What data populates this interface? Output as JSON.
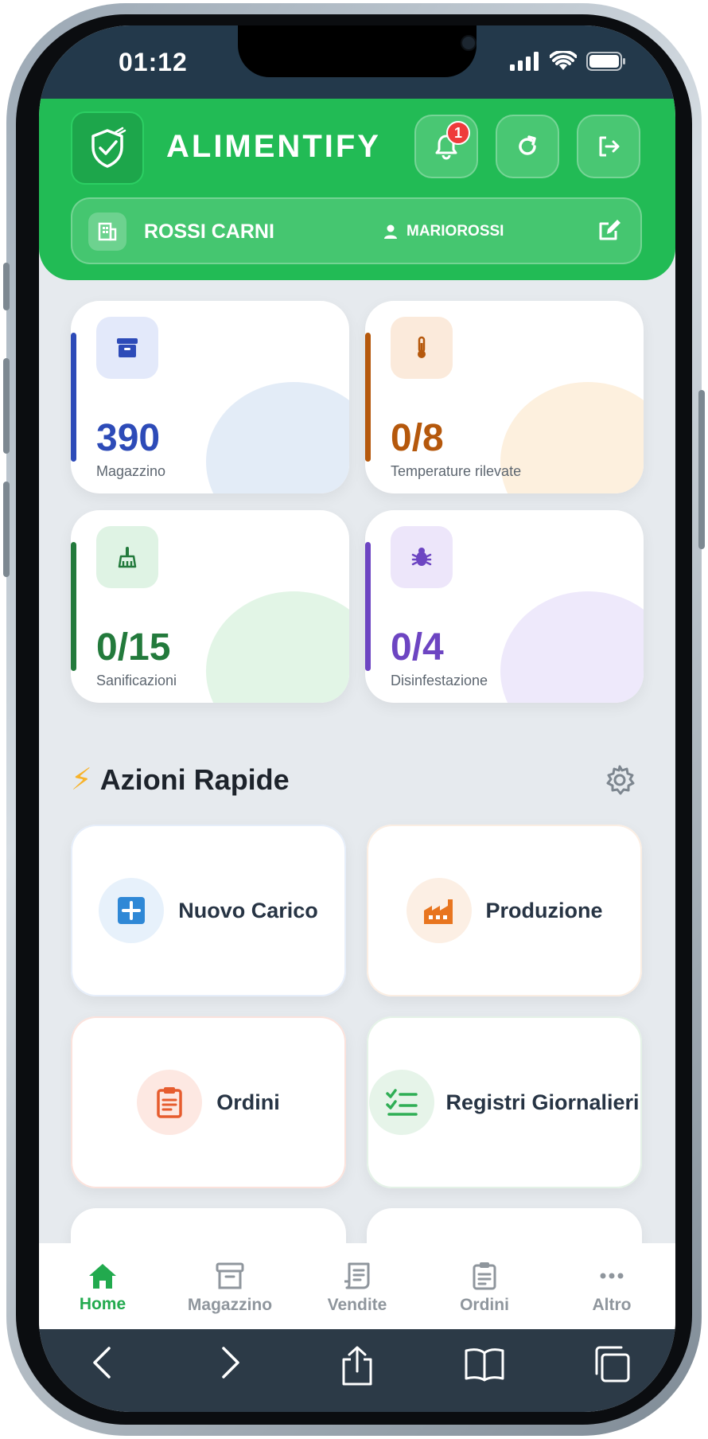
{
  "status_bar": {
    "time": "01:12"
  },
  "header": {
    "brand": "ALIMENTIFY",
    "notifications_count": "1",
    "company_name": "ROSSI CARNI",
    "username": "MARIOROSSI"
  },
  "stats": [
    {
      "value": "390",
      "label": "Magazzino",
      "color": "#2d4bb8",
      "icon": "archive-icon"
    },
    {
      "value": "0/8",
      "label": "Temperature rilevate",
      "color": "#b5580c",
      "icon": "thermometer-icon"
    },
    {
      "value": "0/15",
      "label": "Sanificazioni",
      "color": "#237a3c",
      "icon": "broom-icon"
    },
    {
      "value": "0/4",
      "label": "Disinfestazione",
      "color": "#6d45c2",
      "icon": "bug-icon"
    }
  ],
  "quick_actions": {
    "title": "Azioni Rapide",
    "items": [
      {
        "label": "Nuovo Carico",
        "icon": "plus-square-icon"
      },
      {
        "label": "Produzione",
        "icon": "factory-icon"
      },
      {
        "label": "Ordini",
        "icon": "clipboard-icon"
      },
      {
        "label": "Registri Giornalieri",
        "icon": "checklist-icon"
      }
    ]
  },
  "bottom_nav": [
    {
      "label": "Home",
      "icon": "home-icon",
      "active": true
    },
    {
      "label": "Magazzino",
      "icon": "archive-icon"
    },
    {
      "label": "Vendite",
      "icon": "receipt-icon"
    },
    {
      "label": "Ordini",
      "icon": "clipboard-icon"
    },
    {
      "label": "Altro",
      "icon": "more-dots-icon"
    }
  ],
  "colors": {
    "header_green": "#22bb55",
    "active_nav": "#22aa4e",
    "badge_red": "#ef3b3b"
  }
}
